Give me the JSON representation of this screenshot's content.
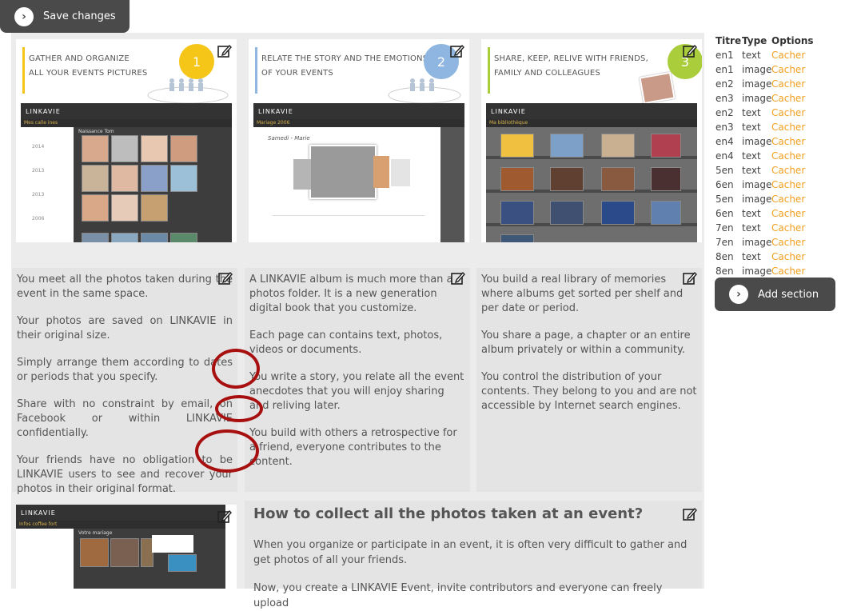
{
  "toolbar": {
    "save_label": "Save changes"
  },
  "cards_top": [
    {
      "title_line1": "GATHER AND ORGANIZE",
      "title_line2": "ALL YOUR EVENTS PICTURES",
      "number": "1",
      "accent": "#f5c518",
      "bar": "#f5c518"
    },
    {
      "title_line1": "RELATE THE STORY AND THE EMOTIONS",
      "title_line2": "OF YOUR EVENTS",
      "number": "2",
      "accent": "#8fb6e0",
      "bar": "#8fb6e0"
    },
    {
      "title_line1": "SHARE, KEEP, RELIVE WITH FRIENDS,",
      "title_line2": "FAMILY AND COLLEAGUES",
      "number": "3",
      "accent": "#a9cd3b",
      "bar": "#a9cd3b"
    }
  ],
  "screens": {
    "brand": "LINKAVIE",
    "card1_sub": "Mes calle ines",
    "card1_panel": "Naissance Tom",
    "card1_years": [
      "2014",
      "2013",
      "2013",
      "2006"
    ],
    "card2_sub": "Mariage 2006",
    "card2_title": "Samedi - Marie",
    "card3_sub": "Ma bibliothèque",
    "bottom_sub": "Infos coffee fort",
    "bottom_panel": "Votre mariage"
  },
  "cards_text": [
    {
      "paragraphs": [
        "You meet all the photos taken during the event in the same space.",
        "Your photos are saved on LINKAVIE in their original size.",
        "Simply arrange them according to dates or periods that you specify.",
        "Share with no constraint by email, on Facebook or within LINKAVIE confidentially.",
        "Your friends have no obligation to be LINKAVIE users to see and recover your photos in their original format."
      ]
    },
    {
      "paragraphs": [
        "A LINKAVIE album is much more than a photos folder. It is a new generation digital book that you customize.",
        "Each page can contains text, photos, videos or documents.",
        "You write a story, you relate all the event anecdotes that you will enjoy sharing and reliving later.",
        "You build with others a retrospective for a friend, everyone contributes to the content."
      ]
    },
    {
      "paragraphs": [
        "You build a real library of memories where albums get sorted per shelf and per date or period.",
        "You share a page, a chapter or an entire album privately or within a community.",
        "You control the distribution of your contents. They belong to you and are not accessible by Internet search engines."
      ]
    }
  ],
  "bottom_section": {
    "title": "How to collect all the photos taken at an event?",
    "body_1": "When you organize or participate in an event, it is often very difficult to gather and get photos of all your friends.",
    "body_2": "Now, you create a LINKAVIE Event, invite contributors and everyone can freely upload"
  },
  "sections_table": {
    "headers": [
      "Titre",
      "Type",
      "Options"
    ],
    "rows": [
      [
        "en1",
        "text",
        "Cacher"
      ],
      [
        "en1",
        "image",
        "Cacher"
      ],
      [
        "en2",
        "image",
        "Cacher"
      ],
      [
        "en3",
        "image",
        "Cacher"
      ],
      [
        "en2",
        "text",
        "Cacher"
      ],
      [
        "en3",
        "text",
        "Cacher"
      ],
      [
        "en4",
        "image",
        "Cacher"
      ],
      [
        "en4",
        "text",
        "Cacher"
      ],
      [
        "5en",
        "text",
        "Cacher"
      ],
      [
        "6en",
        "image",
        "Cacher"
      ],
      [
        "5en",
        "image",
        "Cacher"
      ],
      [
        "6en",
        "text",
        "Cacher"
      ],
      [
        "7en",
        "text",
        "Cacher"
      ],
      [
        "7en",
        "image",
        "Cacher"
      ],
      [
        "8en",
        "text",
        "Cacher"
      ],
      [
        "8en",
        "image",
        "Cacher"
      ]
    ]
  },
  "add_section_label": "Add section",
  "colors": {
    "link": "#f0a020",
    "dark_button": "#4a4a4a",
    "annotation": "#a81010"
  }
}
